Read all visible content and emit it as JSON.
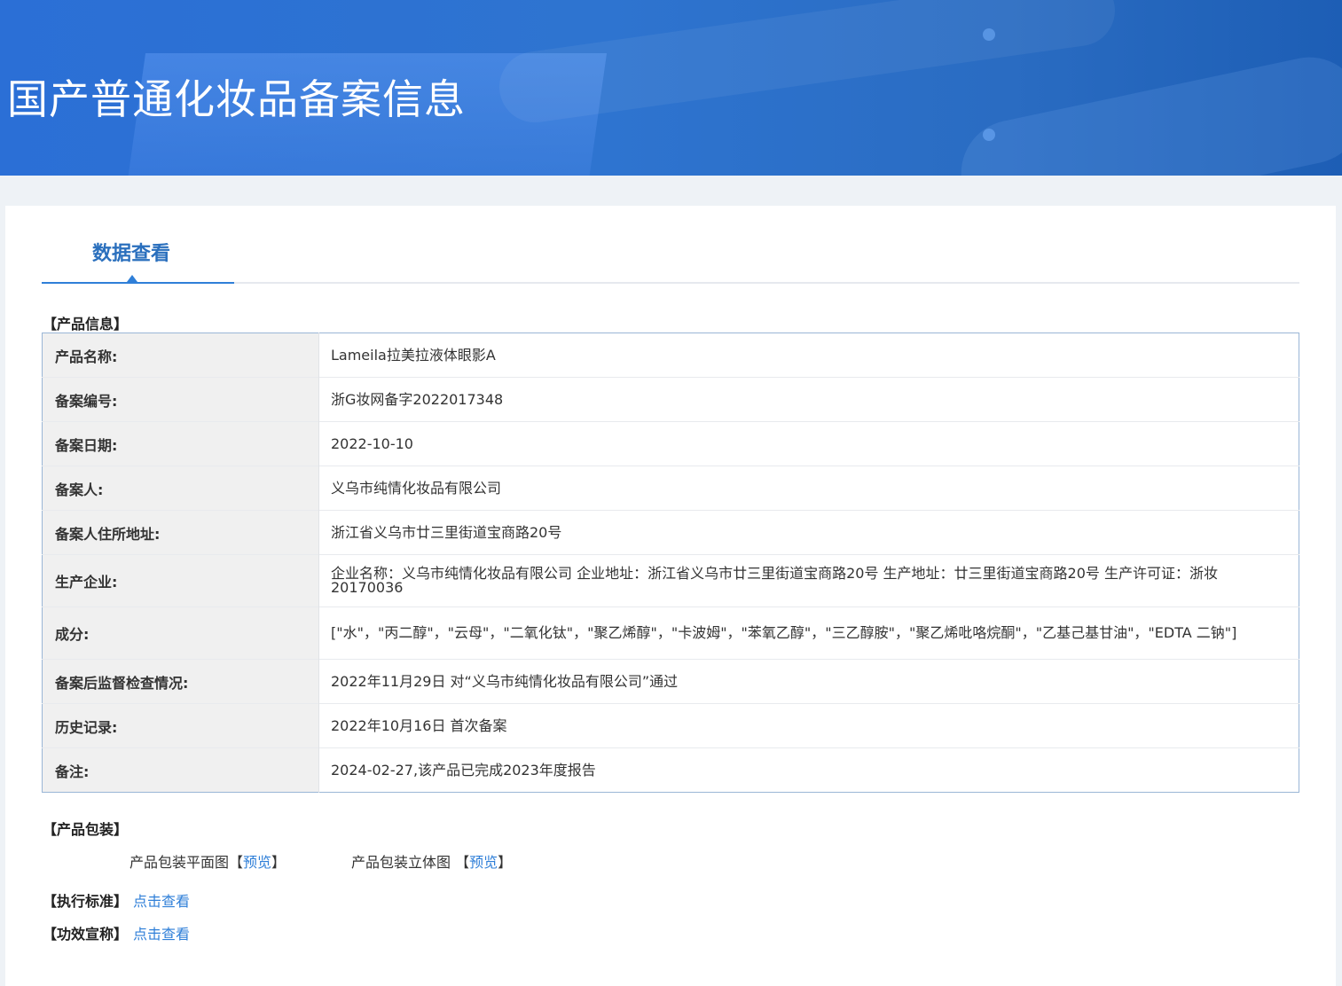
{
  "banner": {
    "title": "国产普通化妆品备案信息"
  },
  "tab": {
    "label": "数据查看"
  },
  "product_info": {
    "heading": "【产品信息】",
    "rows": [
      {
        "label": "产品名称:",
        "value": "Lameila拉美拉液体眼影A"
      },
      {
        "label": "备案编号:",
        "value": "浙G妆网备字2022017348"
      },
      {
        "label": "备案日期:",
        "value": "2022-10-10"
      },
      {
        "label": "备案人:",
        "value": "义乌市纯情化妆品有限公司"
      },
      {
        "label": "备案人住所地址:",
        "value": "浙江省义乌市廿三里街道宝商路20号"
      },
      {
        "label": "生产企业:",
        "value": "企业名称：义乌市纯情化妆品有限公司 企业地址：浙江省义乌市廿三里街道宝商路20号 生产地址：廿三里街道宝商路20号 生产许可证：浙妆20170036"
      },
      {
        "label": "成分:",
        "value": "[\"水\"，\"丙二醇\"，\"云母\"，\"二氧化钛\"，\"聚乙烯醇\"，\"卡波姆\"，\"苯氧乙醇\"，\"三乙醇胺\"，\"聚乙烯吡咯烷酮\"，\"乙基己基甘油\"，\"EDTA 二钠\"]"
      },
      {
        "label": "备案后监督检查情况:",
        "value": "2022年11月29日 对“义乌市纯情化妆品有限公司”通过"
      },
      {
        "label": "历史记录:",
        "value": "2022年10月16日 首次备案"
      },
      {
        "label": "备注:",
        "value": "2024-02-27,该产品已完成2023年度报告"
      }
    ]
  },
  "packaging": {
    "heading": "【产品包装】",
    "flat_label": "产品包装平面图【",
    "flat_link": "预览",
    "flat_close": "】",
    "solid_label": "产品包装立体图 【",
    "solid_link": "预览",
    "solid_close": "】"
  },
  "standard": {
    "label": "【执行标准】",
    "link": "点击查看"
  },
  "efficacy": {
    "label": "【功效宣称】",
    "link": "点击查看"
  }
}
